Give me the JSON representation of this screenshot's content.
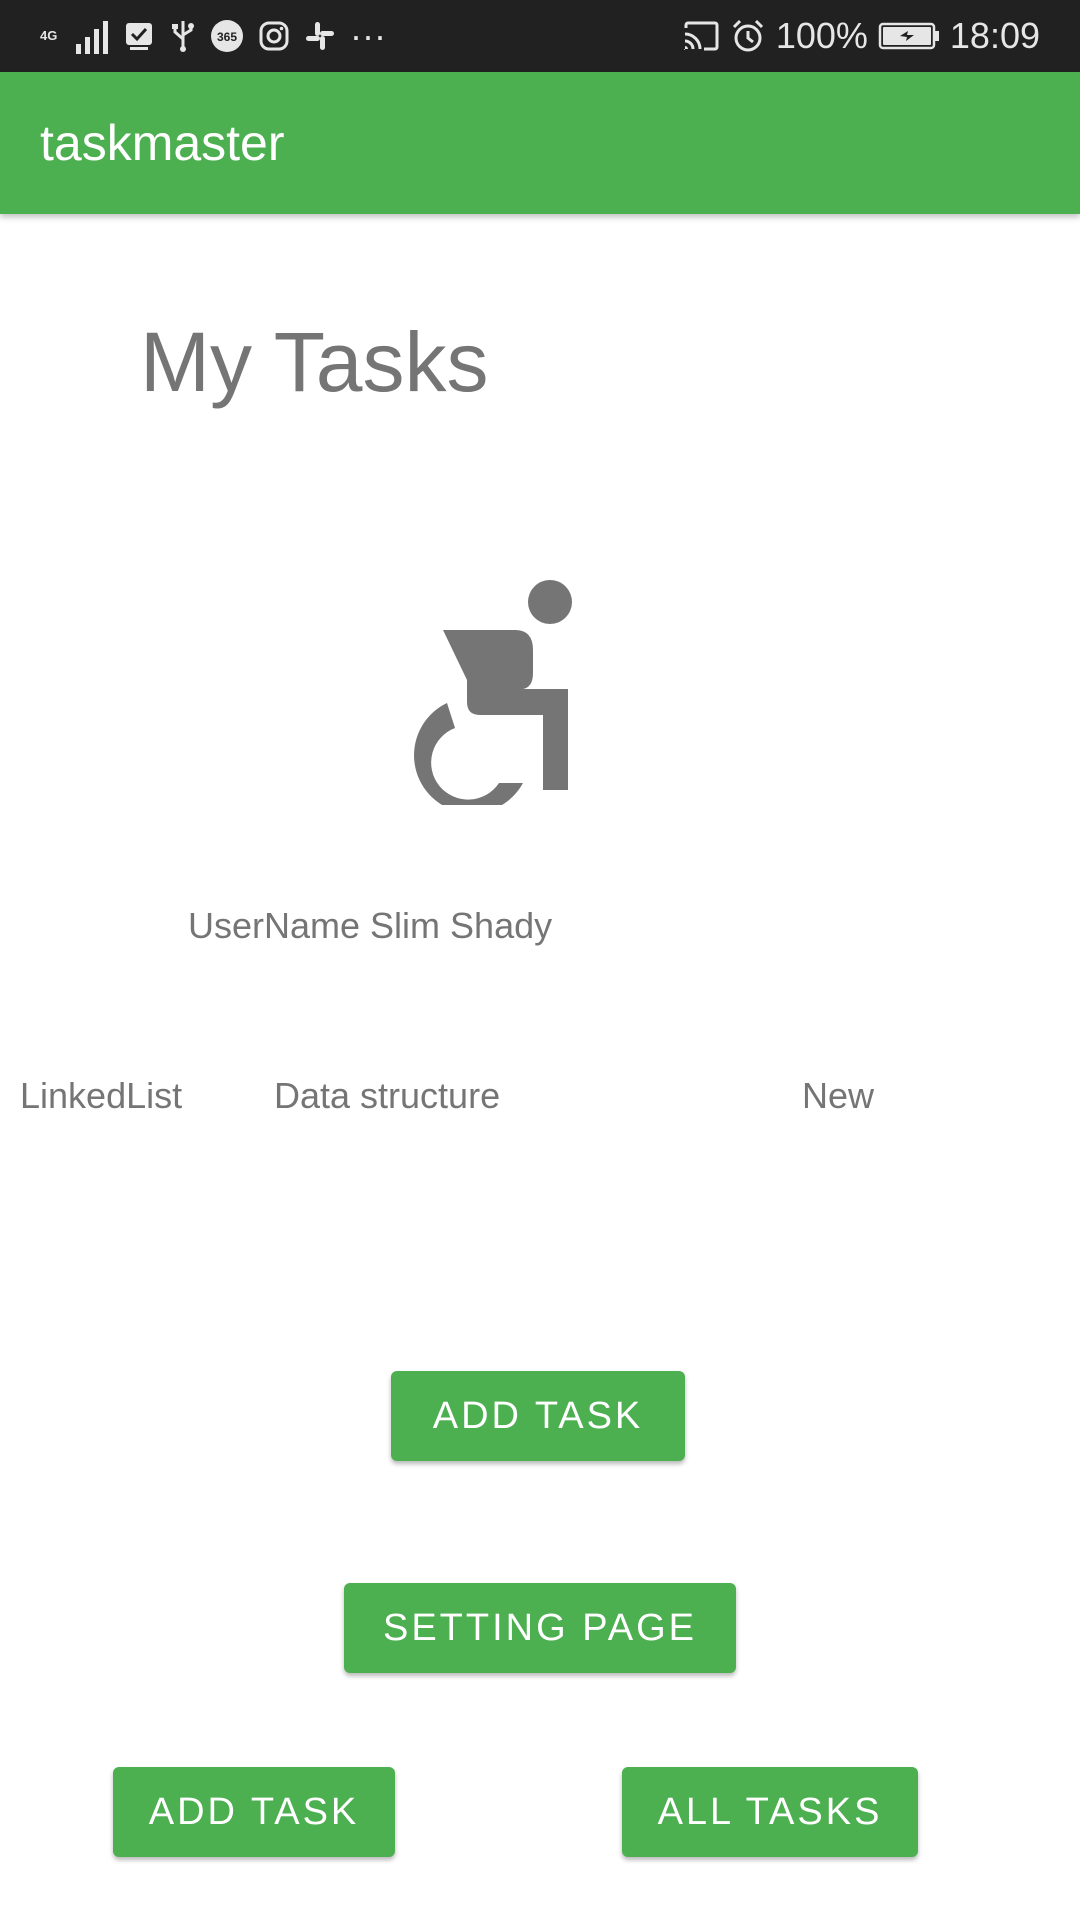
{
  "status_bar": {
    "network_type": "4G",
    "icons_left": [
      "signal-icon",
      "checkbox-icon",
      "usb-icon",
      "app-365-icon",
      "instagram-icon",
      "slack-icon",
      "more-icon"
    ],
    "overflow": "···",
    "icons_right": [
      "cast-icon",
      "alarm-icon",
      "battery-icon"
    ],
    "battery": "100%",
    "time": "18:09"
  },
  "app_bar": {
    "title": "taskmaster"
  },
  "main": {
    "heading": "My Tasks",
    "avatar_icon": "accessible-icon",
    "username": "UserName Slim Shady",
    "task": {
      "title": "LinkedList",
      "body": "Data structure",
      "state": "New"
    }
  },
  "buttons": {
    "add_task": "ADD TASK",
    "setting_page": "SETTING PAGE",
    "add_task_bottom": "ADD TASK",
    "all_tasks": "ALL TASKS"
  },
  "colors": {
    "primary": "#4caf50",
    "status_bar": "#212121",
    "text_gray": "#757575",
    "on_primary": "#ffffff"
  }
}
